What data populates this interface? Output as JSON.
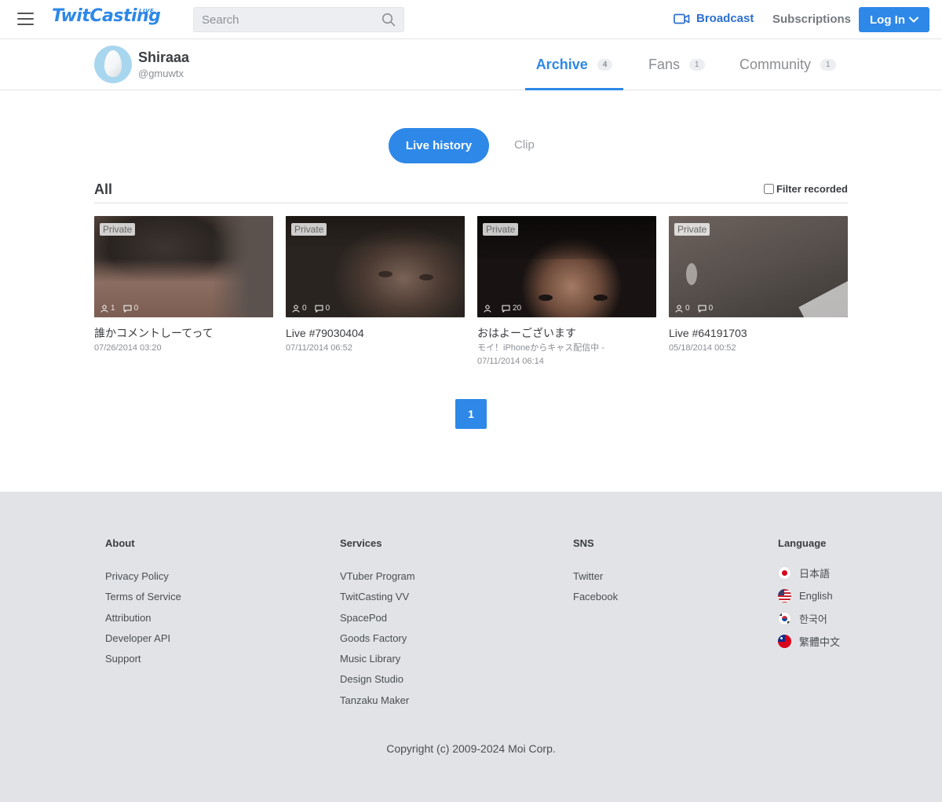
{
  "header": {
    "logo": "TwitCasting",
    "logo_sup": "LIVE",
    "search_placeholder": "Search",
    "broadcast": "Broadcast",
    "subscriptions": "Subscriptions",
    "login": "Log In"
  },
  "profile": {
    "name": "Shiraaa",
    "handle": "@gmuwtx",
    "tabs": [
      {
        "label": "Archive",
        "count": "4",
        "active": true
      },
      {
        "label": "Fans",
        "count": "1",
        "active": false
      },
      {
        "label": "Community",
        "count": "1",
        "active": false
      }
    ]
  },
  "subtabs": {
    "live_history": "Live history",
    "clip": "Clip"
  },
  "section": {
    "title": "All",
    "filter_label": "Filter recorded"
  },
  "cards": [
    {
      "badge": "Private",
      "viewers": "1",
      "comments": "0",
      "title": "誰かコメントしーてって",
      "desc": "",
      "date": "07/26/2014 03:20"
    },
    {
      "badge": "Private",
      "viewers": "0",
      "comments": "0",
      "title": "Live #79030404",
      "desc": "",
      "date": "07/11/2014 06:52"
    },
    {
      "badge": "Private",
      "viewers": "",
      "comments": "20",
      "title": "おはよーございます",
      "desc": "モイ！iPhoneからキャス配信中 -",
      "date": "07/11/2014 06:14"
    },
    {
      "badge": "Private",
      "viewers": "0",
      "comments": "0",
      "title": "Live #64191703",
      "desc": "",
      "date": "05/18/2014 00:52"
    }
  ],
  "pagination": {
    "current": "1"
  },
  "footer": {
    "about": {
      "title": "About",
      "links": [
        "Privacy Policy",
        "Terms of Service",
        "Attribution",
        "Developer API",
        "Support"
      ]
    },
    "services": {
      "title": "Services",
      "links": [
        "VTuber Program",
        "TwitCasting VV",
        "SpacePod",
        "Goods Factory",
        "Music Library",
        "Design Studio",
        "Tanzaku Maker"
      ]
    },
    "sns": {
      "title": "SNS",
      "links": [
        "Twitter",
        "Facebook"
      ]
    },
    "language": {
      "title": "Language",
      "items": [
        {
          "label": "日本語",
          "flag": "japan-flag-icon"
        },
        {
          "label": "English",
          "flag": "usa-flag-icon"
        },
        {
          "label": "한국어",
          "flag": "korea-flag-icon"
        },
        {
          "label": "繁體中文",
          "flag": "taiwan-flag-icon"
        }
      ]
    },
    "copyright": "Copyright (c) 2009-2024 Moi Corp."
  },
  "colors": {
    "accent": "#2d88e8",
    "footer_bg": "#e1e3e6"
  }
}
